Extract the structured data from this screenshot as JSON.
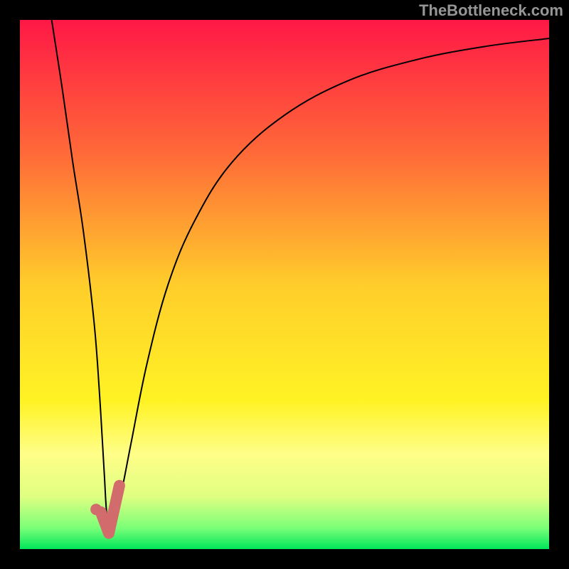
{
  "watermark": "TheBottleneck.com",
  "chart_data": {
    "type": "line",
    "title": "",
    "xlabel": "",
    "ylabel": "",
    "xlim": [
      0,
      100
    ],
    "ylim": [
      0,
      100
    ],
    "axes_visible": false,
    "background": "vertical-gradient",
    "gradient_stops": [
      {
        "offset": 0.0,
        "color": "#ff1846"
      },
      {
        "offset": 0.25,
        "color": "#ff6938"
      },
      {
        "offset": 0.5,
        "color": "#ffcd2b"
      },
      {
        "offset": 0.72,
        "color": "#fff324"
      },
      {
        "offset": 0.82,
        "color": "#fffe88"
      },
      {
        "offset": 0.9,
        "color": "#e0ff82"
      },
      {
        "offset": 0.96,
        "color": "#7bff78"
      },
      {
        "offset": 1.0,
        "color": "#00e65b"
      }
    ],
    "series": [
      {
        "name": "bottleneck-curve",
        "color": "#000000",
        "stroke_width": 2,
        "x": [
          6.0,
          8.0,
          10.0,
          12.0,
          14.0,
          15.0,
          15.9,
          16.5,
          17.5,
          19.0,
          21.0,
          24.0,
          28.0,
          33.0,
          40.0,
          50.0,
          62.0,
          75.0,
          88.0,
          100.0
        ],
        "y": [
          100.0,
          87.0,
          73.0,
          60.0,
          43.0,
          30.0,
          15.0,
          6.0,
          5.5,
          10.0,
          20.0,
          35.0,
          50.0,
          62.0,
          73.0,
          82.0,
          88.5,
          92.5,
          95.0,
          96.5
        ]
      },
      {
        "name": "highlight-check",
        "color": "#d26b6b",
        "stroke_width": 16,
        "linecap": "round",
        "x": [
          15.3,
          16.8,
          18.8
        ],
        "y": [
          7.0,
          3.0,
          12.0
        ]
      }
    ],
    "points": [
      {
        "name": "highlight-dot",
        "x": 14.4,
        "y": 7.5,
        "r": 8,
        "color": "#d26b6b"
      }
    ]
  }
}
